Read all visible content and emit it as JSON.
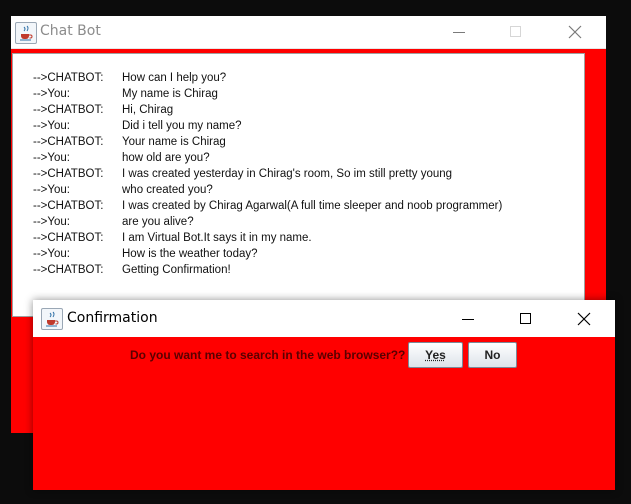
{
  "chat_window": {
    "title": "Chat Bot",
    "icon": "java-coffee-icon",
    "controls": [
      "minimize-icon",
      "maximize-icon",
      "close-icon"
    ],
    "background_color": "#ff0000",
    "messages": [
      {
        "sender": "-->CHATBOT:",
        "text": "How can I help you?"
      },
      {
        "sender": "-->You:",
        "text": "My name is Chirag"
      },
      {
        "sender": "-->CHATBOT:",
        "text": "Hi,  Chirag"
      },
      {
        "sender": "-->You:",
        "text": "Did i tell you my name?"
      },
      {
        "sender": "-->CHATBOT:",
        "text": "Your name is  Chirag"
      },
      {
        "sender": "-->You:",
        "text": "how old are you?"
      },
      {
        "sender": "-->CHATBOT:",
        "text": "I was created yesterday in Chirag's room, So im still pretty young"
      },
      {
        "sender": "-->You:",
        "text": "who created you?"
      },
      {
        "sender": "-->CHATBOT:",
        "text": "I was created by Chirag Agarwal(A full time sleeper and noob programmer)"
      },
      {
        "sender": "-->You:",
        "text": "are you alive?"
      },
      {
        "sender": "-->CHATBOT:",
        "text": "I am Virtual Bot.It says it in my name."
      },
      {
        "sender": "-->You:",
        "text": "How is the weather today?"
      },
      {
        "sender": "-->CHATBOT:",
        "text": "Getting Confirmation!"
      }
    ]
  },
  "confirm_dialog": {
    "title": "Confirmation",
    "icon": "java-coffee-icon",
    "question": "Do you want me to search in the web browser??",
    "yes_label": "Yes",
    "no_label": "No",
    "background_color": "#ff0000"
  }
}
